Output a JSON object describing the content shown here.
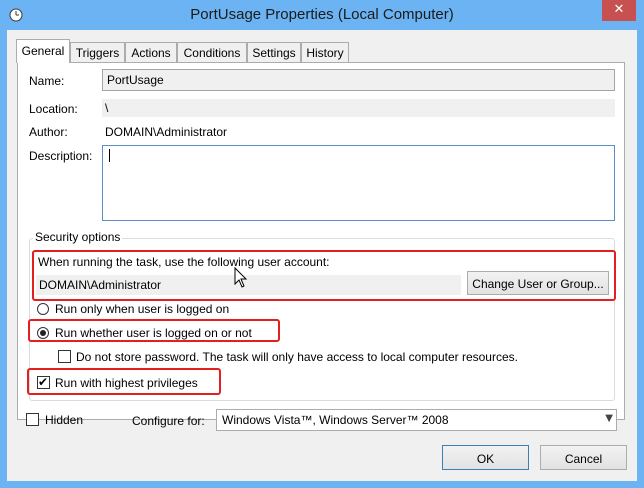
{
  "window": {
    "title": "PortUsage Properties (Local Computer)",
    "close_glyph": "✕",
    "accent": "#6bb3f2"
  },
  "tabs": [
    {
      "label": "General",
      "active": true
    },
    {
      "label": "Triggers"
    },
    {
      "label": "Actions"
    },
    {
      "label": "Conditions"
    },
    {
      "label": "Settings"
    },
    {
      "label": "History"
    }
  ],
  "general": {
    "name_label": "Name:",
    "name_value": "PortUsage",
    "location_label": "Location:",
    "location_value": "\\",
    "author_label": "Author:",
    "author_value": "DOMAIN\\Administrator",
    "description_label": "Description:",
    "description_value": ""
  },
  "security": {
    "group_label": "Security options",
    "account_prompt": "When running the task, use the following user account:",
    "account_value": "DOMAIN\\Administrator",
    "change_button": "Change User or Group...",
    "radio_logged_on": "Run only when user is logged on",
    "radio_whether": "Run whether user is logged on or not",
    "no_store_password": "Do not store password.  The task will only have access to local computer resources.",
    "highest_privileges": "Run with highest privileges",
    "highlight_color": "#e32020"
  },
  "bottom": {
    "hidden_label": "Hidden",
    "configure_label": "Configure for:",
    "configure_value": "Windows Vista™, Windows Server™ 2008",
    "dropdown_glyph": "▼"
  },
  "buttons": {
    "ok": "OK",
    "cancel": "Cancel"
  },
  "icons": {
    "title": "clock-icon",
    "cursor": "mouse-pointer-icon"
  }
}
